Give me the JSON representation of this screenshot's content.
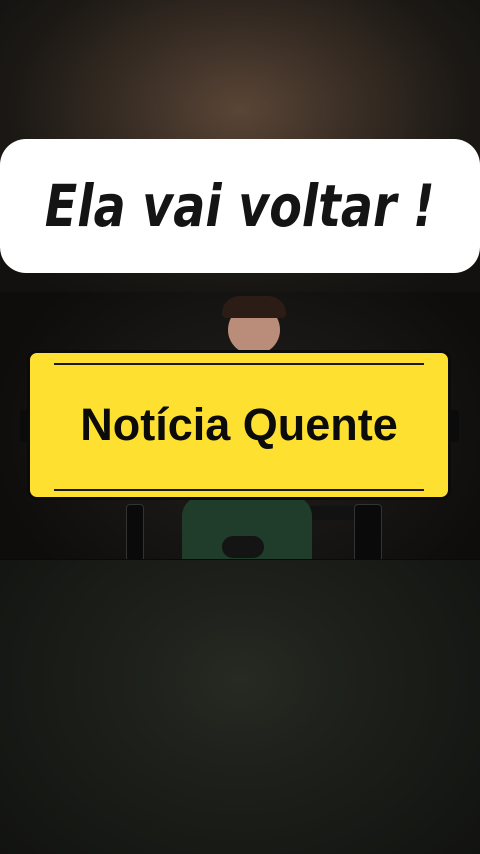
{
  "headline": {
    "text": "Ela vai voltar !"
  },
  "badge": {
    "text": "Notícia Quente"
  },
  "video": {
    "description_icon": "person-seated-icon"
  },
  "colors": {
    "badge_bg": "#fde030",
    "headline_bg": "#ffffff",
    "text": "#0b0b0b",
    "background": "#141310"
  }
}
